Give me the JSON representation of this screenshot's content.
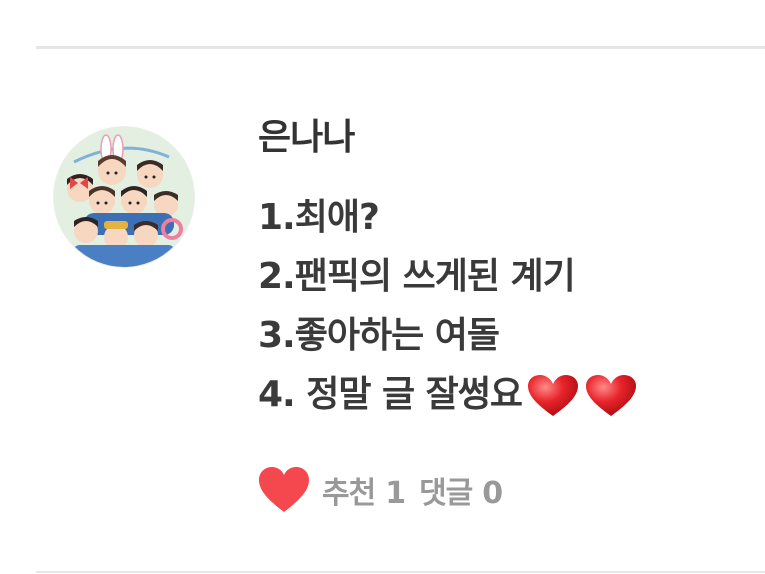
{
  "post": {
    "author": "은나나",
    "lines": [
      "1.최애?",
      "2.팬픽의 쓰게된 계기",
      "3.좋아하는 여돌",
      "4. 정말 글 잘썽요"
    ],
    "emoji_after_last_line": [
      "red-heart",
      "red-heart"
    ]
  },
  "footer": {
    "like_label": "추천",
    "like_count": "1",
    "comment_label": "댓글",
    "comment_count": "0"
  },
  "colors": {
    "heart": "#f5474e",
    "text": "#333333",
    "meta": "#999999",
    "divider": "#e6e6e6"
  }
}
